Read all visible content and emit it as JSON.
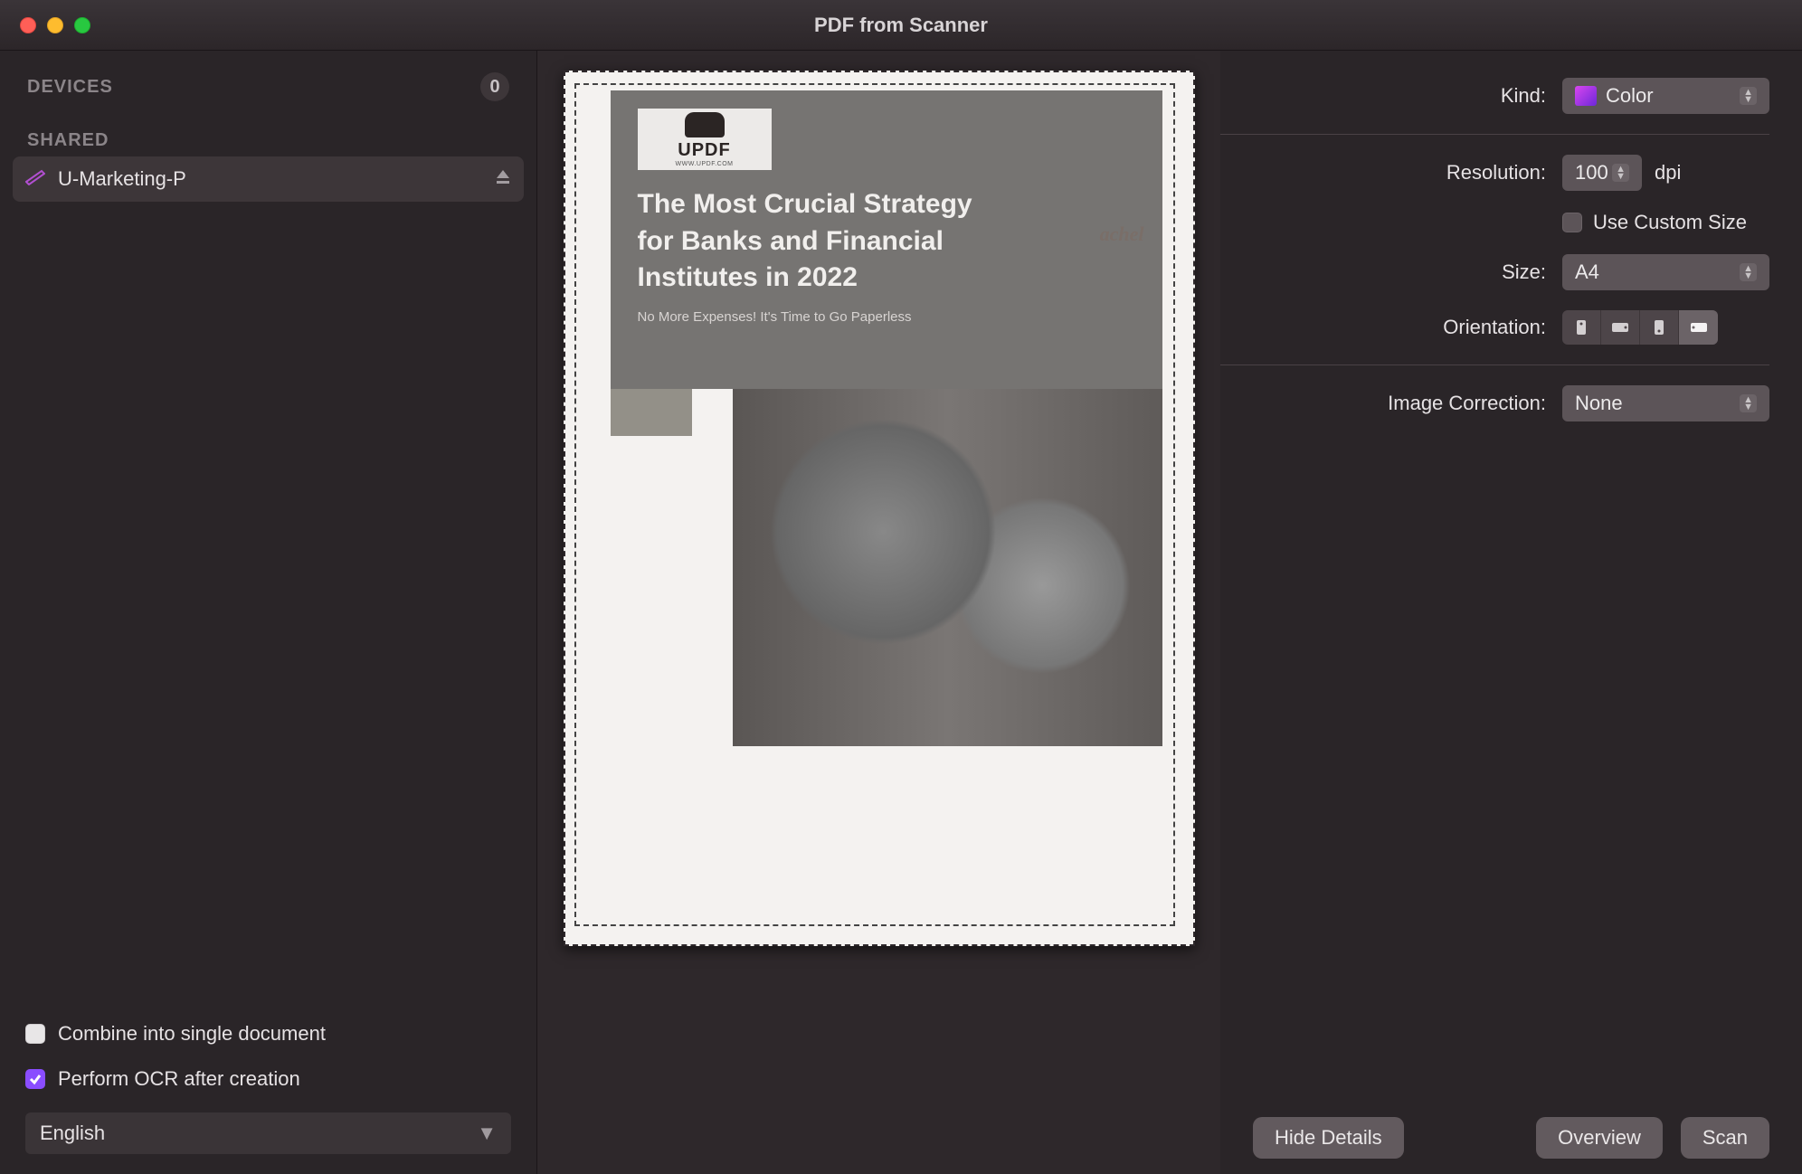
{
  "window": {
    "title": "PDF from Scanner"
  },
  "sidebar": {
    "devices_label": "DEVICES",
    "devices_count": "0",
    "shared_label": "SHARED",
    "items": [
      {
        "name": "U-Marketing-P"
      }
    ],
    "combine_label": "Combine into single document",
    "combine_checked": false,
    "ocr_label": "Perform OCR after creation",
    "ocr_checked": true,
    "language": "English"
  },
  "preview": {
    "logo_text": "UPDF",
    "logo_url": "WWW.UPDF.COM",
    "doc_title_l1": "The Most Crucial Strategy",
    "doc_title_l2": "for Banks and Financial",
    "doc_title_l3": "Institutes in 2022",
    "annotation": "achel",
    "subtitle": "No More Expenses! It's Time to Go Paperless"
  },
  "settings": {
    "kind_label": "Kind:",
    "kind_value": "Color",
    "resolution_label": "Resolution:",
    "resolution_value": "100",
    "resolution_unit": "dpi",
    "custom_size_label": "Use Custom Size",
    "size_label": "Size:",
    "size_value": "A4",
    "orientation_label": "Orientation:",
    "image_correction_label": "Image Correction:",
    "image_correction_value": "None"
  },
  "footer": {
    "hide_details": "Hide Details",
    "overview": "Overview",
    "scan": "Scan"
  }
}
